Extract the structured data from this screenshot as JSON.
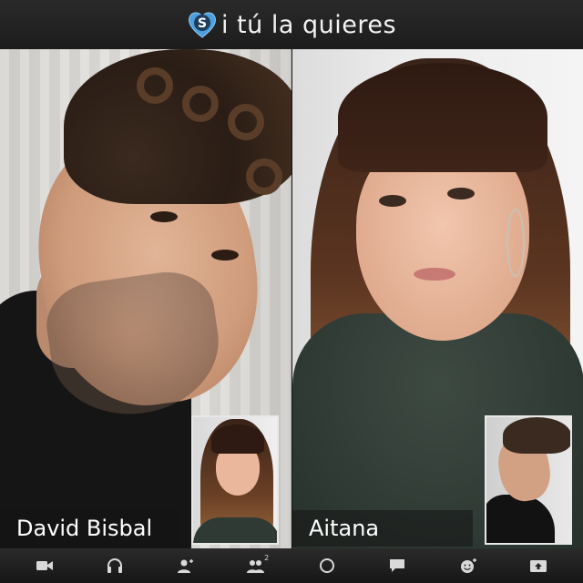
{
  "header": {
    "logo_letter": "S",
    "title": "i tú la quieres",
    "logo_color": "#5aa9e6"
  },
  "participants": [
    {
      "name": "David Bisbal"
    },
    {
      "name": "Aitana"
    }
  ],
  "toolbar": {
    "buttons": [
      {
        "icon": "video-camera-icon"
      },
      {
        "icon": "headphones-icon"
      },
      {
        "icon": "add-contact-icon"
      },
      {
        "icon": "contacts-icon",
        "badge": "2"
      },
      {
        "icon": "record-icon"
      },
      {
        "icon": "chat-icon"
      },
      {
        "icon": "emoji-icon"
      },
      {
        "icon": "share-screen-icon"
      }
    ]
  }
}
